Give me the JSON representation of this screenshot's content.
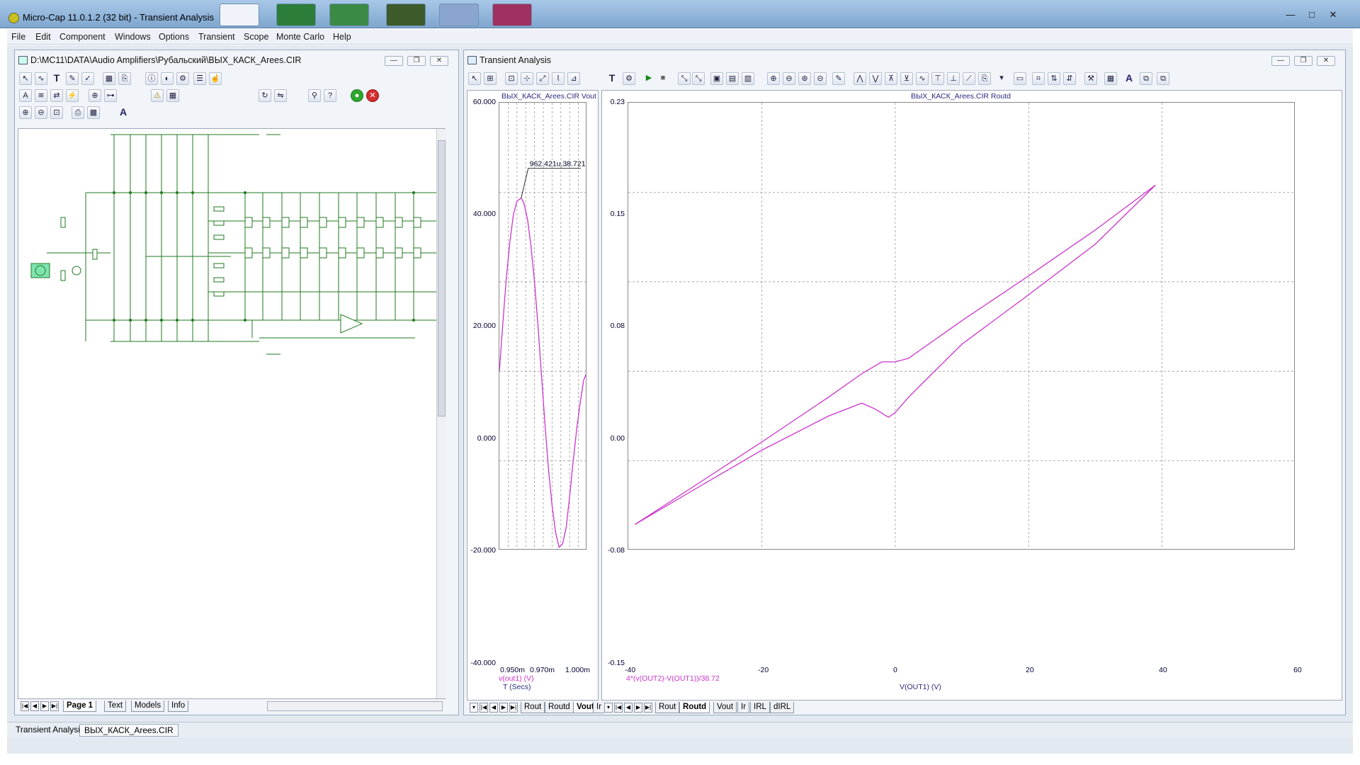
{
  "app": {
    "title": "Micro-Cap 11.0.1.2 (32 bit) - Transient Analysis",
    "menu": [
      "File",
      "Edit",
      "Component",
      "Windows",
      "Options",
      "Transient",
      "Scope",
      "Monte Carlo",
      "Help"
    ]
  },
  "schematic": {
    "path": "D:\\MC11\\DATA\\Audio Amplifiers\\Рубальский\\ВЫХ_КАСК_Areеs.CIR",
    "tabs": [
      "Page 1",
      "Text",
      "Models",
      "Info"
    ]
  },
  "transient": {
    "title": "Transient Analysis",
    "left_plot": {
      "title": "ВЫХ_КАСК_Areеs.CIR Vout",
      "cursor_label": "962.421u,38.721",
      "expr": "v(out1) (V)",
      "xlabel": "T (Secs)",
      "tabs": [
        "Rout",
        "Routd",
        "Vout",
        "Ir"
      ],
      "active_tab": "Vout"
    },
    "right_plot": {
      "title": "ВЫХ_КАСК_Areеs.CIR Routd",
      "expr": "4*(v(OUT2)-V(OUT1))/38.72",
      "xlabel": "V(OUT1) (V)",
      "tabs": [
        "Rout",
        "Routd",
        "Vout",
        "Ir",
        "IRL",
        "dIRL"
      ],
      "active_tab": "Routd"
    }
  },
  "status_tabs": [
    "Transient Analysis",
    "ВЫХ_КАСК_Areеs.CIR"
  ],
  "colors": {
    "trace": "#cc33cc",
    "grid": "#9a9a9a",
    "accent": "#2a2a80"
  },
  "chart_data": [
    {
      "type": "line",
      "title": "ВЫХ_КАСК_Areеs.CIR Vout",
      "xlabel": "T (Secs)",
      "ylabel": "v(out1) (V)",
      "x_ticks": [
        "0.950m",
        "0.970m",
        "1.000m"
      ],
      "y_ticks": [
        "60.000",
        "40.000",
        "20.000",
        "0.000",
        "-20.000",
        "-40.000"
      ],
      "xlim": [
        0.95,
        1.0
      ],
      "ylim": [
        -40,
        60
      ],
      "grid": true,
      "series": [
        {
          "x_ms": [
            0.95,
            0.952,
            0.954,
            0.956,
            0.958,
            0.96,
            0.9624,
            0.964,
            0.966,
            0.968,
            0.97,
            0.972,
            0.974,
            0.976,
            0.978,
            0.98,
            0.982,
            0.984,
            0.986,
            0.988,
            0.99,
            0.992,
            0.994,
            0.996,
            0.998,
            1.0
          ],
          "y": [
            0,
            11,
            21,
            29,
            35,
            38,
            38.72,
            37.5,
            34,
            28,
            20,
            10,
            -1,
            -12,
            -22,
            -30,
            -36,
            -39.3,
            -38.5,
            -35,
            -28,
            -20,
            -13,
            -7,
            -2,
            0
          ]
        }
      ]
    },
    {
      "type": "line",
      "title": "ВЫХ_КАСК_Areеs.CIR Routd",
      "xlabel": "V(OUT1) (V)",
      "ylabel": "4*(v(OUT2)-V(OUT1))/38.72",
      "x_ticks": [
        "-40",
        "-20",
        "0",
        "20",
        "40",
        "60"
      ],
      "y_ticks": [
        "0.23",
        "0.15",
        "0.08",
        "0.00",
        "-0.08",
        "-0.15"
      ],
      "xlim": [
        -40,
        60
      ],
      "ylim": [
        -0.15,
        0.23
      ],
      "grid": true,
      "series": [
        {
          "x": [
            -39,
            -30,
            -20,
            -10,
            -5,
            -2,
            0,
            2,
            5,
            10,
            20,
            30,
            39
          ],
          "y": [
            -0.128,
            -0.095,
            -0.058,
            -0.02,
            0.0,
            0.01,
            0.01,
            0.013,
            0.025,
            0.045,
            0.083,
            0.122,
            0.16
          ]
        },
        {
          "x": [
            -39,
            -30,
            -20,
            -10,
            -5,
            -3,
            -1,
            0,
            2,
            5,
            10,
            20,
            30,
            39
          ],
          "y": [
            -0.128,
            -0.098,
            -0.065,
            -0.036,
            -0.025,
            -0.03,
            -0.037,
            -0.033,
            -0.02,
            -0.003,
            0.025,
            0.067,
            0.11,
            0.16
          ]
        }
      ]
    }
  ]
}
